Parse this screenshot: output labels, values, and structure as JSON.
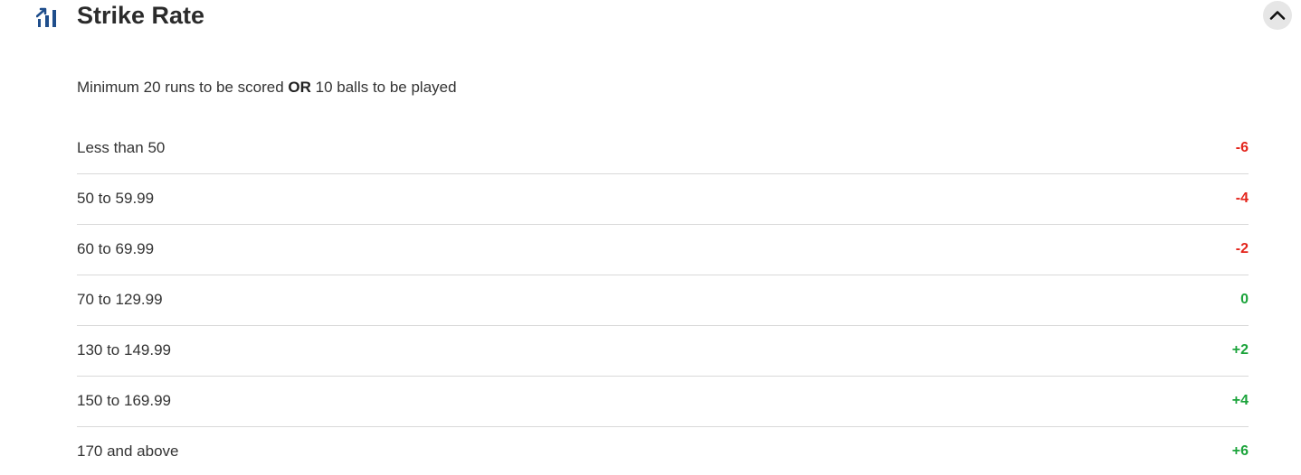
{
  "header": {
    "icon": "bar-chart-rising-icon",
    "title": "Strike Rate",
    "collapse_icon": "chevron-up-icon"
  },
  "note": {
    "prefix": "Minimum 20 runs to be scored",
    "connector": "OR",
    "suffix": "10 balls to be played"
  },
  "rules": [
    {
      "label": "Less than 50",
      "points": "-6",
      "tone": "neg"
    },
    {
      "label": "50 to 59.99",
      "points": "-4",
      "tone": "neg"
    },
    {
      "label": "60 to 69.99",
      "points": "-2",
      "tone": "neg"
    },
    {
      "label": "70 to 129.99",
      "points": "0",
      "tone": "pos"
    },
    {
      "label": "130 to 149.99",
      "points": "+2",
      "tone": "pos"
    },
    {
      "label": "150 to 169.99",
      "points": "+4",
      "tone": "pos"
    },
    {
      "label": "170 and above",
      "points": "+6",
      "tone": "pos"
    }
  ],
  "colors": {
    "icon": "#1f4e8c",
    "negative": "#e3231a",
    "positive": "#1aa33a",
    "divider": "#d9d9d9",
    "collapse_bg": "#e6e6e6"
  }
}
